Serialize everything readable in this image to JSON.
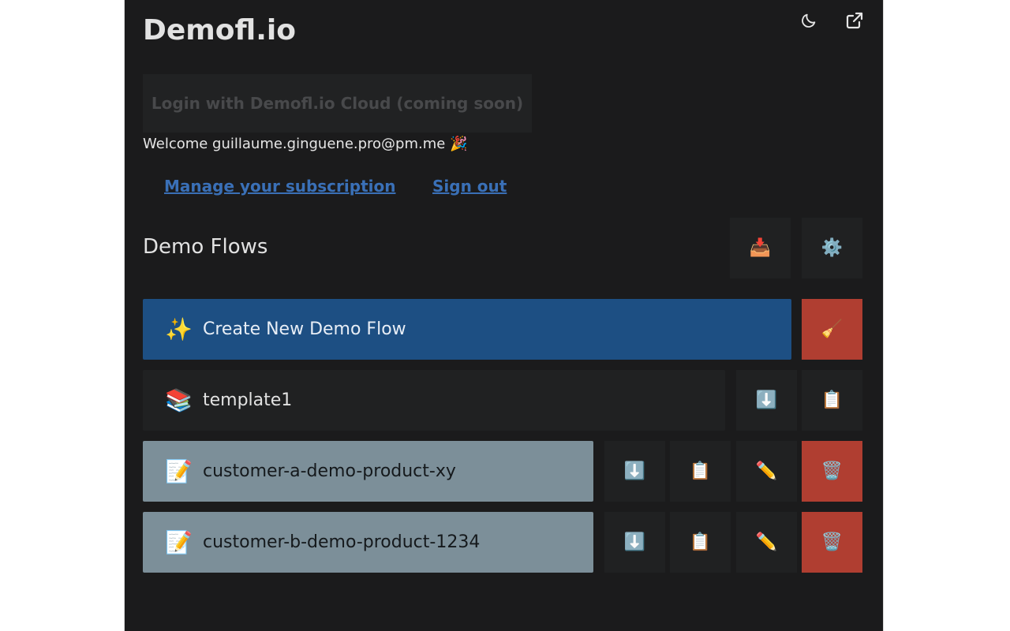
{
  "app": {
    "title": "Demofl.io"
  },
  "header_icons": [
    {
      "name": "moon-icon",
      "glyph": "☾"
    },
    {
      "name": "external-link-icon",
      "glyph": "↗"
    }
  ],
  "login": {
    "label": "Login with Demofl.io Cloud (coming soon)"
  },
  "welcome": {
    "text": "Welcome guillaume.ginguene.pro@pm.me 🎉"
  },
  "links": {
    "subscription": "Manage your subscription",
    "sign_out": "Sign out"
  },
  "section": {
    "title": "Demo Flows",
    "import_icon": "📥",
    "settings_icon": "⚙️"
  },
  "create": {
    "emoji": "✨",
    "label": "Create New Demo Flow",
    "clear_icon": "🧹"
  },
  "template": {
    "emoji": "📚",
    "label": "template1",
    "download_icon": "⬇️",
    "copy_icon": "📋"
  },
  "flows": [
    {
      "emoji": "📝",
      "label": "customer-a-demo-product-xy",
      "download_icon": "⬇️",
      "copy_icon": "📋",
      "edit_icon": "✏️",
      "delete_icon": "🗑️"
    },
    {
      "emoji": "📝",
      "label": "customer-b-demo-product-1234",
      "download_icon": "⬇️",
      "copy_icon": "📋",
      "edit_icon": "✏️",
      "delete_icon": "🗑️"
    }
  ],
  "colors": {
    "background": "#1b1b1c",
    "create_button": "#1d4f83",
    "danger": "#b03e31",
    "flow_item": "#7c8f99",
    "link": "#3a70b7"
  }
}
